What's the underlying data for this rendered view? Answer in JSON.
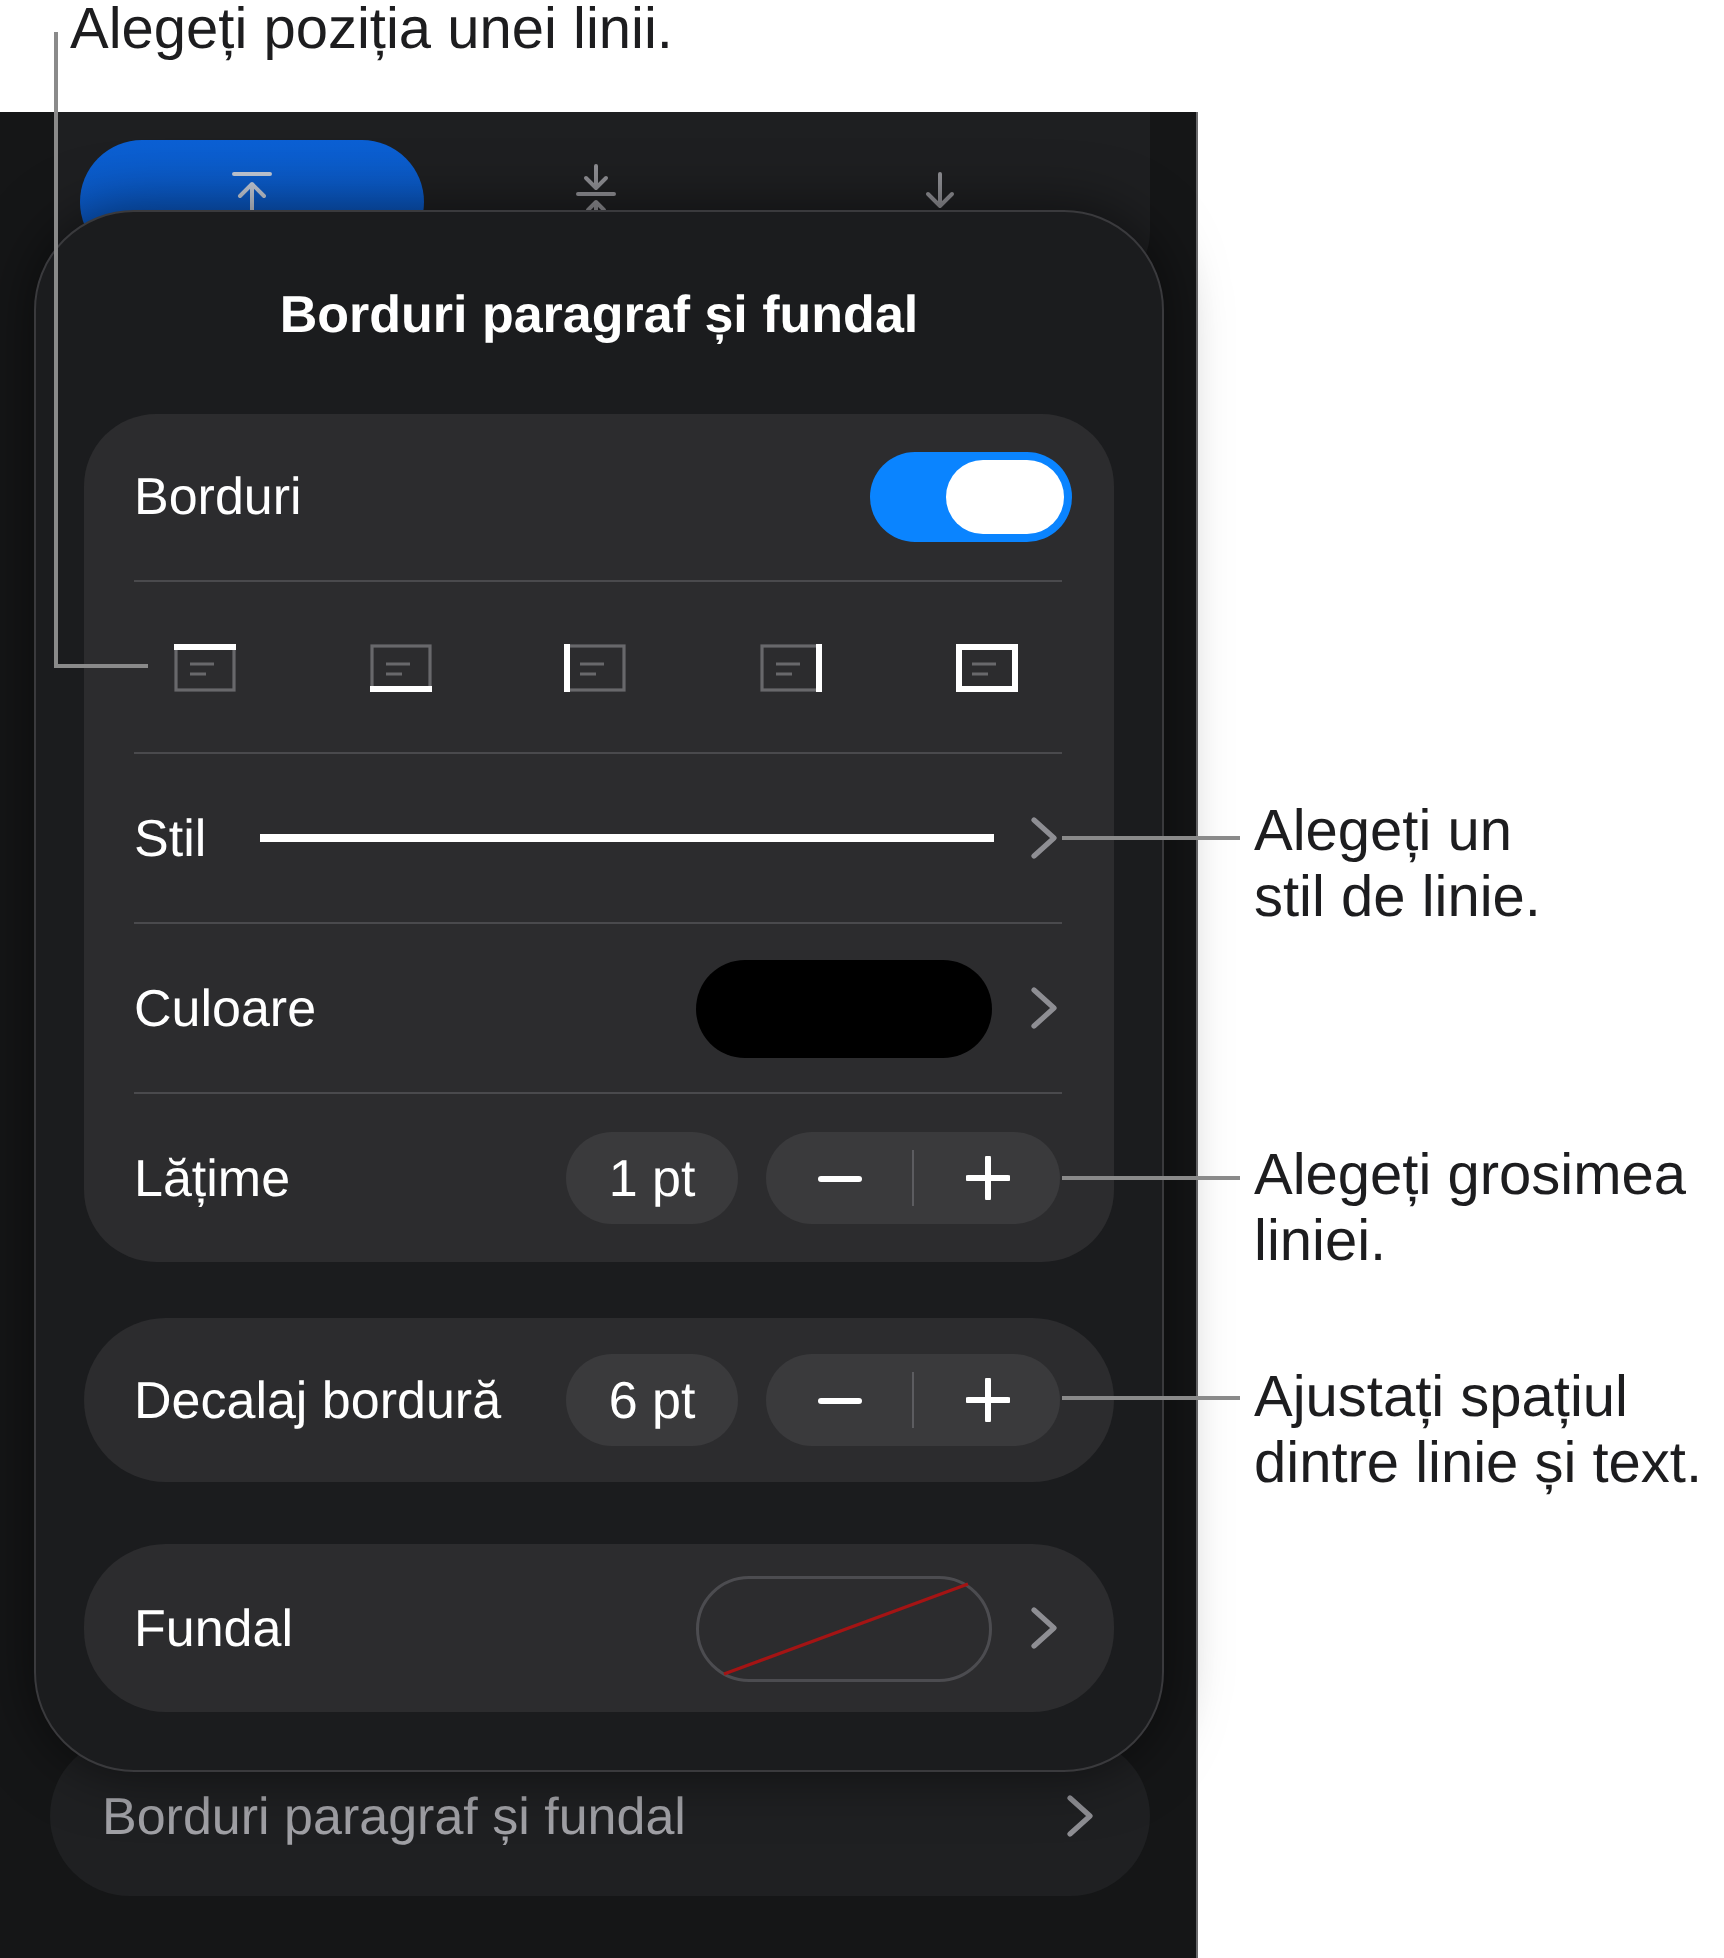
{
  "callouts": [
    {
      "lines": [
        "Alegeți poziția unei linii."
      ]
    },
    {
      "lines": [
        "Alegeți un",
        "stil de linie."
      ]
    },
    {
      "lines": [
        "Alegeți grosimea",
        "liniei."
      ]
    },
    {
      "lines": [
        "Ajustați spațiul",
        "dintre linie și text."
      ]
    }
  ],
  "background": {
    "alignment": [
      {
        "kind": "top",
        "selected": true
      },
      {
        "kind": "middle",
        "selected": false
      },
      {
        "kind": "bottom",
        "selected": false
      }
    ],
    "row": {
      "label": "Borduri paragraf și fundal"
    }
  },
  "popup": {
    "title": "Borduri paragraf și fundal",
    "borders": {
      "label": "Borduri",
      "on": true
    },
    "positions": [
      {
        "kind": "top"
      },
      {
        "kind": "bottom"
      },
      {
        "kind": "left"
      },
      {
        "kind": "right"
      },
      {
        "kind": "all"
      }
    ],
    "style": {
      "label": "Stil"
    },
    "color": {
      "label": "Culoare",
      "color": "#000000"
    },
    "width": {
      "label": "Lățime",
      "value": "1 pt"
    },
    "offset": {
      "label": "Decalaj bordură",
      "value": "6 pt"
    },
    "fill": {
      "label": "Fundal"
    }
  }
}
